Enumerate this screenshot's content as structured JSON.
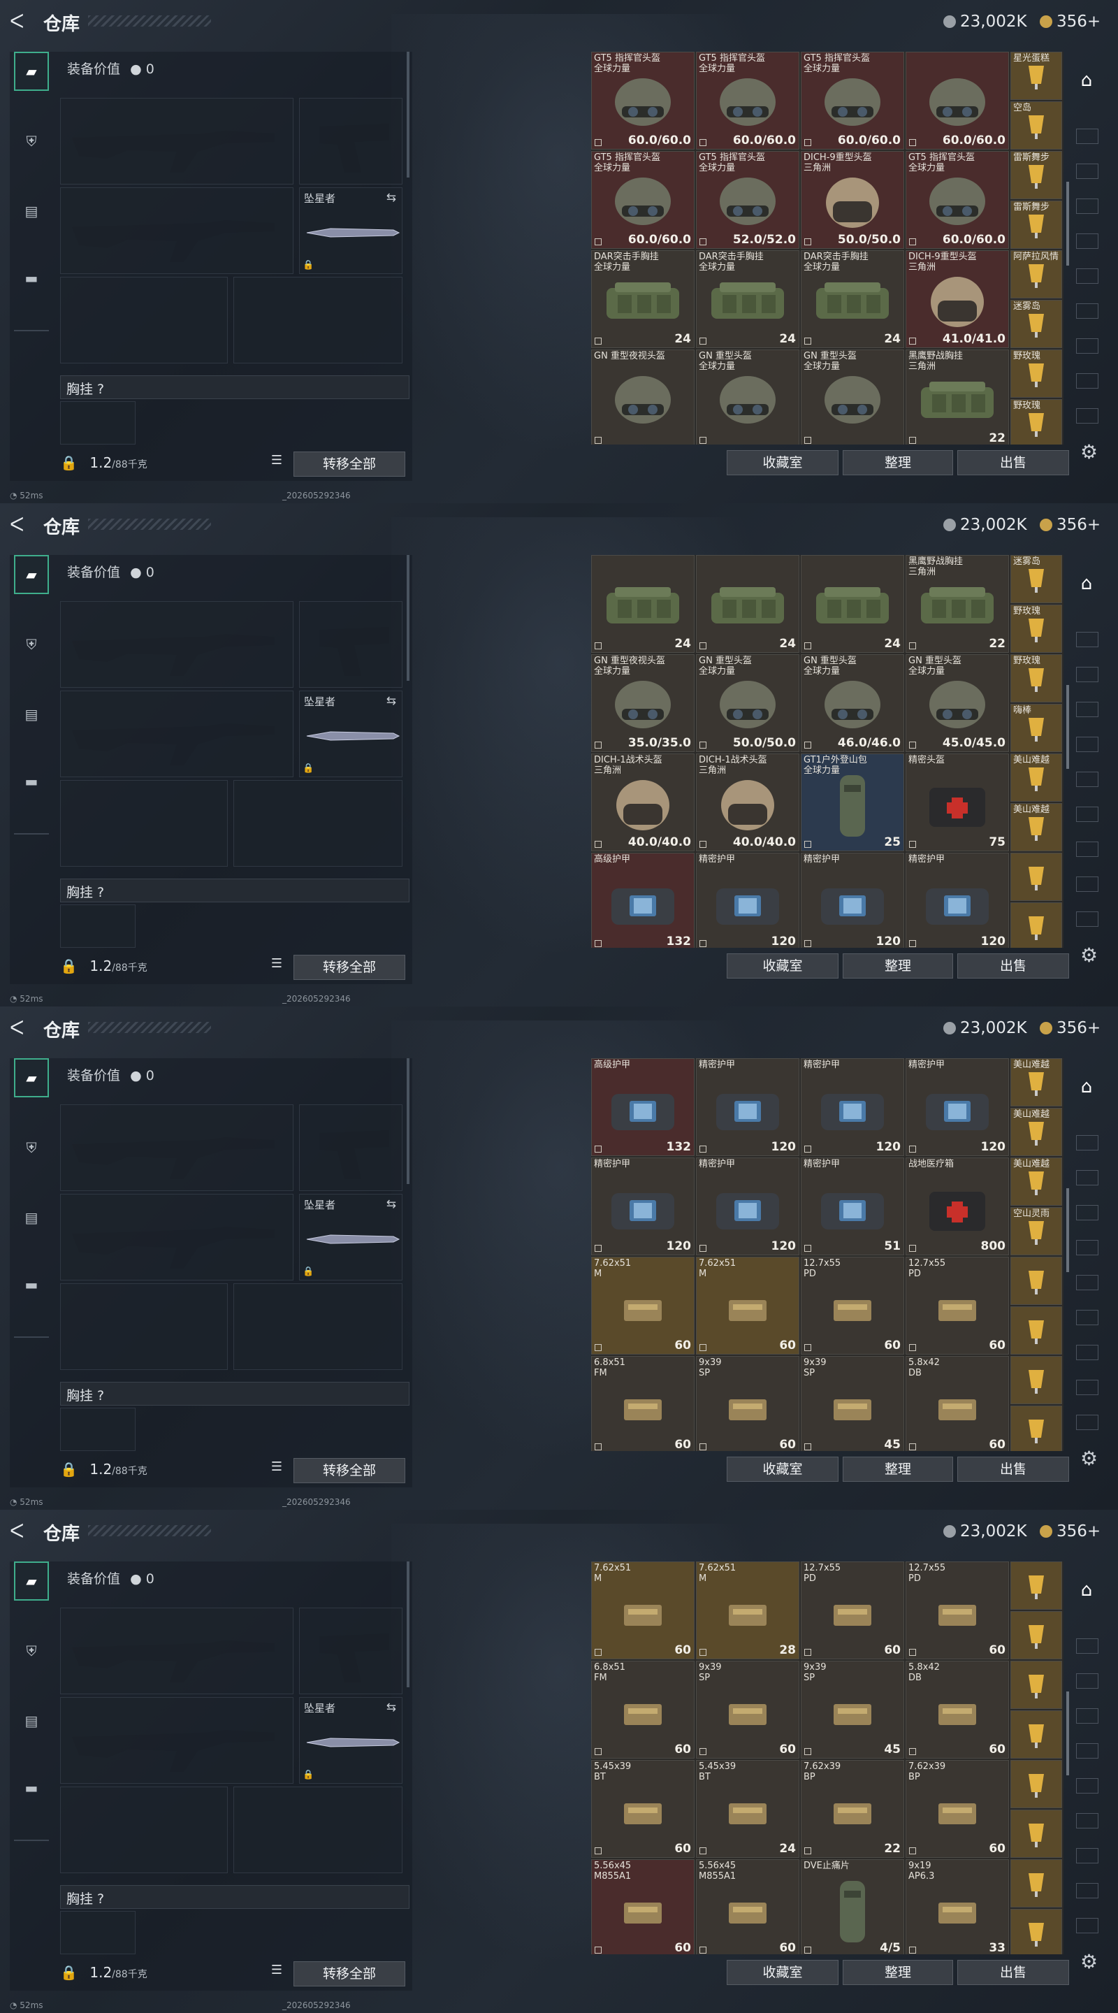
{
  "app": {
    "title": "仓库",
    "back_glyph": "ᐸ"
  },
  "currency": {
    "silver": "23,002K",
    "gold": "356+"
  },
  "left": {
    "equip_value_label": "装备价值",
    "equip_value": "0",
    "melee_slot_label": "坠星者",
    "chest_label": "胸挂 ?",
    "weight": "1.2",
    "weight_unit": "/88千克",
    "transfer_all": "转移全部"
  },
  "actions": {
    "favorites": "收藏室",
    "sort": "整理",
    "sell": "出售"
  },
  "status": {
    "ping": "52ms",
    "serial": "_202605292346"
  },
  "colors": {
    "accent": "#3fae8c",
    "red_cell": "#4a2c2c",
    "gold_cell": "#5a4a2a"
  },
  "screens": [
    {
      "cells": [
        {
          "name": "GT5 指挥官头盔\n全球力量",
          "val": "60.0/60.0",
          "tone": "red",
          "art": "helmet"
        },
        {
          "name": "GT5 指挥官头盔\n全球力量",
          "val": "60.0/60.0",
          "tone": "red",
          "art": "helmet"
        },
        {
          "name": "GT5 指挥官头盔\n全球力量",
          "val": "60.0/60.0",
          "tone": "red",
          "art": "helmet"
        },
        {
          "name": "",
          "val": "60.0/60.0",
          "tone": "red",
          "art": "helmet"
        },
        {
          "name": "GT5 指挥官头盔\n全球力量",
          "val": "60.0/60.0",
          "tone": "red",
          "art": "helmet"
        },
        {
          "name": "GT5 指挥官头盔\n全球力量",
          "val": "52.0/52.0",
          "tone": "red",
          "art": "helmet"
        },
        {
          "name": "DICH-9重型头盔\n三角洲",
          "val": "50.0/50.0",
          "tone": "red",
          "art": "helmet2"
        },
        {
          "name": "GT5 指挥官头盔\n全球力量",
          "val": "60.0/60.0",
          "tone": "red",
          "art": "helmet"
        },
        {
          "name": "DAR突击手胸挂\n全球力量",
          "val": "24",
          "tone": "",
          "art": "rig"
        },
        {
          "name": "DAR突击手胸挂\n全球力量",
          "val": "24",
          "tone": "",
          "art": "rig"
        },
        {
          "name": "DAR突击手胸挂\n全球力量",
          "val": "24",
          "tone": "",
          "art": "rig"
        },
        {
          "name": "DICH-9重型头盔\n三角洲",
          "val": "41.0/41.0",
          "tone": "red",
          "art": "helmet2"
        },
        {
          "name": "GN 重型夜视头盔",
          "val": "",
          "tone": "",
          "art": "helmet"
        },
        {
          "name": "GN 重型头盔\n全球力量",
          "val": "",
          "tone": "",
          "art": "helmet"
        },
        {
          "name": "GN 重型头盔\n全球力量",
          "val": "",
          "tone": "",
          "art": "helmet"
        },
        {
          "name": "黑鹰野战胸挂\n三角洲",
          "val": "22",
          "tone": "",
          "art": "rig"
        }
      ],
      "side": [
        "星光蛋糕",
        "空岛",
        "雷斯舞步",
        "雷斯舞步",
        "阿萨拉风情",
        "迷雾岛",
        "野玫瑰",
        "野玫瑰"
      ]
    },
    {
      "cells": [
        {
          "name": "",
          "val": "24",
          "tone": "",
          "art": "rig"
        },
        {
          "name": "",
          "val": "24",
          "tone": "",
          "art": "rig"
        },
        {
          "name": "",
          "val": "24",
          "tone": "",
          "art": "rig"
        },
        {
          "name": "黑鹰野战胸挂\n三角洲",
          "val": "22",
          "tone": "",
          "art": "rig"
        },
        {
          "name": "GN 重型夜视头盔\n全球力量",
          "val": "35.0/35.0",
          "tone": "",
          "art": "helmet"
        },
        {
          "name": "GN 重型头盔\n全球力量",
          "val": "50.0/50.0",
          "tone": "",
          "art": "helmet"
        },
        {
          "name": "GN 重型头盔\n全球力量",
          "val": "46.0/46.0",
          "tone": "",
          "art": "helmet"
        },
        {
          "name": "GN 重型头盔\n全球力量",
          "val": "45.0/45.0",
          "tone": "",
          "art": "helmet"
        },
        {
          "name": "DICH-1战术头盔\n三角洲",
          "val": "40.0/40.0",
          "tone": "",
          "art": "helmet2"
        },
        {
          "name": "DICH-1战术头盔\n三角洲",
          "val": "40.0/40.0",
          "tone": "",
          "art": "helmet2"
        },
        {
          "name": "GT1户外登山包\n全球力量",
          "val": "25",
          "tone": "blue",
          "art": "pack"
        },
        {
          "name": "精密头盔",
          "val": "75",
          "tone": "",
          "art": "medkit"
        },
        {
          "name": "高级护甲",
          "val": "132",
          "tone": "red",
          "art": "armor"
        },
        {
          "name": "精密护甲",
          "val": "120",
          "tone": "",
          "art": "armor"
        },
        {
          "name": "精密护甲",
          "val": "120",
          "tone": "",
          "art": "armor"
        },
        {
          "name": "精密护甲",
          "val": "120",
          "tone": "",
          "art": "armor"
        }
      ],
      "side": [
        "迷雾岛",
        "野玫瑰",
        "野玫瑰",
        "嗨棒",
        "美山难越",
        "美山难越",
        "",
        ""
      ]
    },
    {
      "cells": [
        {
          "name": "高级护甲",
          "val": "132",
          "tone": "red",
          "art": "armor"
        },
        {
          "name": "精密护甲",
          "val": "120",
          "tone": "",
          "art": "armor"
        },
        {
          "name": "精密护甲",
          "val": "120",
          "tone": "",
          "art": "armor"
        },
        {
          "name": "精密护甲",
          "val": "120",
          "tone": "",
          "art": "armor"
        },
        {
          "name": "精密护甲",
          "val": "120",
          "tone": "",
          "art": "armor"
        },
        {
          "name": "精密护甲",
          "val": "120",
          "tone": "",
          "art": "armor"
        },
        {
          "name": "精密护甲",
          "val": "51",
          "tone": "",
          "art": "armor"
        },
        {
          "name": "战地医疗箱",
          "val": "800",
          "tone": "",
          "art": "medkit"
        },
        {
          "name": "7.62x51\nM",
          "val": "60",
          "tone": "gold",
          "art": "ammo"
        },
        {
          "name": "7.62x51\nM",
          "val": "60",
          "tone": "gold",
          "art": "ammo"
        },
        {
          "name": "12.7x55\nPD",
          "val": "60",
          "tone": "",
          "art": "ammo"
        },
        {
          "name": "12.7x55\nPD",
          "val": "60",
          "tone": "",
          "art": "ammo"
        },
        {
          "name": "6.8x51\nFM",
          "val": "60",
          "tone": "",
          "art": "ammo"
        },
        {
          "name": "9x39\nSP",
          "val": "60",
          "tone": "",
          "art": "ammo"
        },
        {
          "name": "9x39\nSP",
          "val": "45",
          "tone": "",
          "art": "ammo"
        },
        {
          "name": "5.8x42\nDB",
          "val": "60",
          "tone": "",
          "art": "ammo"
        }
      ],
      "side": [
        "美山难越",
        "美山难越",
        "美山难越",
        "空山灵雨",
        "",
        "",
        "",
        ""
      ]
    },
    {
      "cells": [
        {
          "name": "7.62x51\nM",
          "val": "60",
          "tone": "gold",
          "art": "ammo"
        },
        {
          "name": "7.62x51\nM",
          "val": "28",
          "tone": "gold",
          "art": "ammo"
        },
        {
          "name": "12.7x55\nPD",
          "val": "60",
          "tone": "",
          "art": "ammo"
        },
        {
          "name": "12.7x55\nPD",
          "val": "60",
          "tone": "",
          "art": "ammo"
        },
        {
          "name": "6.8x51\nFM",
          "val": "60",
          "tone": "",
          "art": "ammo"
        },
        {
          "name": "9x39\nSP",
          "val": "60",
          "tone": "",
          "art": "ammo"
        },
        {
          "name": "9x39\nSP",
          "val": "45",
          "tone": "",
          "art": "ammo"
        },
        {
          "name": "5.8x42\nDB",
          "val": "60",
          "tone": "",
          "art": "ammo"
        },
        {
          "name": "5.45x39\nBT",
          "val": "60",
          "tone": "",
          "art": "ammo"
        },
        {
          "name": "5.45x39\nBT",
          "val": "24",
          "tone": "",
          "art": "ammo"
        },
        {
          "name": "7.62x39\nBP",
          "val": "22",
          "tone": "",
          "art": "ammo"
        },
        {
          "name": "7.62x39\nBP",
          "val": "60",
          "tone": "",
          "art": "ammo"
        },
        {
          "name": "5.56x45\nM855A1",
          "val": "60",
          "tone": "red",
          "art": "ammo"
        },
        {
          "name": "5.56x45\nM855A1",
          "val": "60",
          "tone": "",
          "art": "ammo"
        },
        {
          "name": "DVE止痛片",
          "val": "4/5",
          "tone": "",
          "art": "pack"
        },
        {
          "name": "9x19\nAP6.3",
          "val": "33",
          "tone": "",
          "art": "ammo"
        }
      ],
      "side": [
        "",
        "",
        "",
        "",
        "",
        "",
        "",
        ""
      ]
    }
  ]
}
